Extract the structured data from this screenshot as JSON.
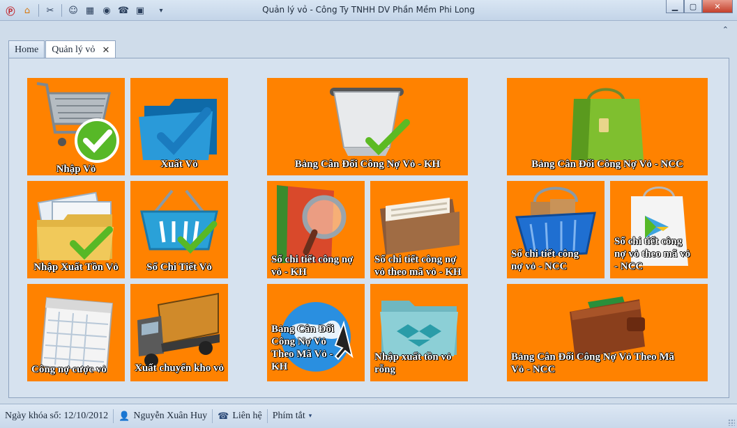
{
  "window": {
    "title": "Quản lý vỏ - Công Ty TNHH DV Phần Mềm Phi Long",
    "controls": {
      "minimize": "▁",
      "maximize": "▢",
      "close": "✕"
    }
  },
  "quick_access": [
    {
      "name": "app-logo-icon",
      "glyph": "Ⓟ"
    },
    {
      "name": "home-icon",
      "glyph": "⌂"
    },
    {
      "name": "tools-icon",
      "glyph": "✂"
    },
    {
      "name": "users-icon",
      "glyph": "☺"
    },
    {
      "name": "film-icon",
      "glyph": "▦"
    },
    {
      "name": "eye-icon",
      "glyph": "◉"
    },
    {
      "name": "phone-icon",
      "glyph": "☎"
    },
    {
      "name": "grid-icon",
      "glyph": "▣"
    },
    {
      "name": "dropdown-icon",
      "glyph": "▾"
    }
  ],
  "ribbon_toggle": "⌃",
  "tabs": [
    {
      "label": "Home"
    },
    {
      "label": "Quản lý vỏ",
      "close": "✕"
    }
  ],
  "tiles": {
    "nhap_vo": "Nhập Vỏ",
    "xuat_vo": "Xuất Vỏ",
    "bang_can_doi_kh": "Bảng Cân Đối Công Nợ Vỏ - KH",
    "bang_can_doi_ncc": "Bảng Cân Đối Công Nợ Vỏ  - NCC",
    "nhap_xuat_ton_vo": "Nhập Xuất Tồn Vỏ",
    "so_chi_tiet_vo": "Sổ Chi Tiết Vỏ",
    "so_chi_tiet_cong_no_kh": [
      "Sổ chi tiết công nợ",
      "vỏ - KH"
    ],
    "so_chi_tiet_theo_ma_kh": [
      "Sổ chi tiết công nợ",
      "vỏ theo mã vỏ - KH"
    ],
    "so_chi_tiet_cong_no_ncc": [
      "Sổ chi tiết công",
      "nợ vỏ - NCC"
    ],
    "so_chi_tiet_theo_ma_ncc": [
      "Sổ chi tiết công",
      "nợ vỏ theo mã vỏ",
      "- NCC"
    ],
    "cong_no_cuoc_vo": "Công nợ cược vỏ",
    "xuat_chuyen_kho_vo": "Xuất chuyển kho vỏ",
    "bang_can_doi_theo_ma_kh": [
      "Bảng Cân Đối",
      "Công Nợ Vỏ",
      "Theo Mã Vỏ -",
      "KH"
    ],
    "nhap_xuat_ton_vo_rong": [
      "Nhập xuất tồn vỏ",
      "rỗng"
    ],
    "bang_can_doi_theo_ma_ncc": [
      "Bảng Cân Đối Công Nợ Vỏ Theo Mã",
      "Vỏ - NCC"
    ]
  },
  "statusbar": {
    "lock_date_label": "Ngày khóa sổ: 12/10/2012",
    "user": "Nguyễn Xuân Huy",
    "contact": "Liên hệ",
    "shortcuts": "Phím tắt"
  },
  "colors": {
    "tile": "#ff8200",
    "check": "#4fb81f"
  }
}
